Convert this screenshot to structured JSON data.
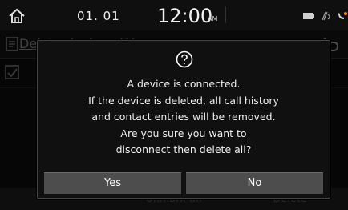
{
  "status_bar": {
    "date": "01. 01",
    "time": "12:00",
    "ampm": "AM",
    "icons": [
      "home-icon",
      "battery-icon",
      "signal-icon",
      "bluetooth-phone-icon"
    ]
  },
  "list": {
    "title": "Delete devices (1)",
    "title_icon": "delete-list-icon",
    "back_icon": "back-icon"
  },
  "bottom_bar": {
    "unmark_all_label": "Unmark all",
    "delete_label": "Delete"
  },
  "dialog": {
    "icon": "question-icon",
    "message_lines": [
      "A device is connected.",
      "If the device is deleted, all call history",
      "and contact entries will be removed.",
      "Are you sure you want to",
      "disconnect then delete all?"
    ],
    "yes_label": "Yes",
    "no_label": "No"
  },
  "colors": {
    "background": "#0c0c0c",
    "dialog_bg": "#101010",
    "button_bg": "#4d4d4d",
    "text": "#ffffff"
  }
}
